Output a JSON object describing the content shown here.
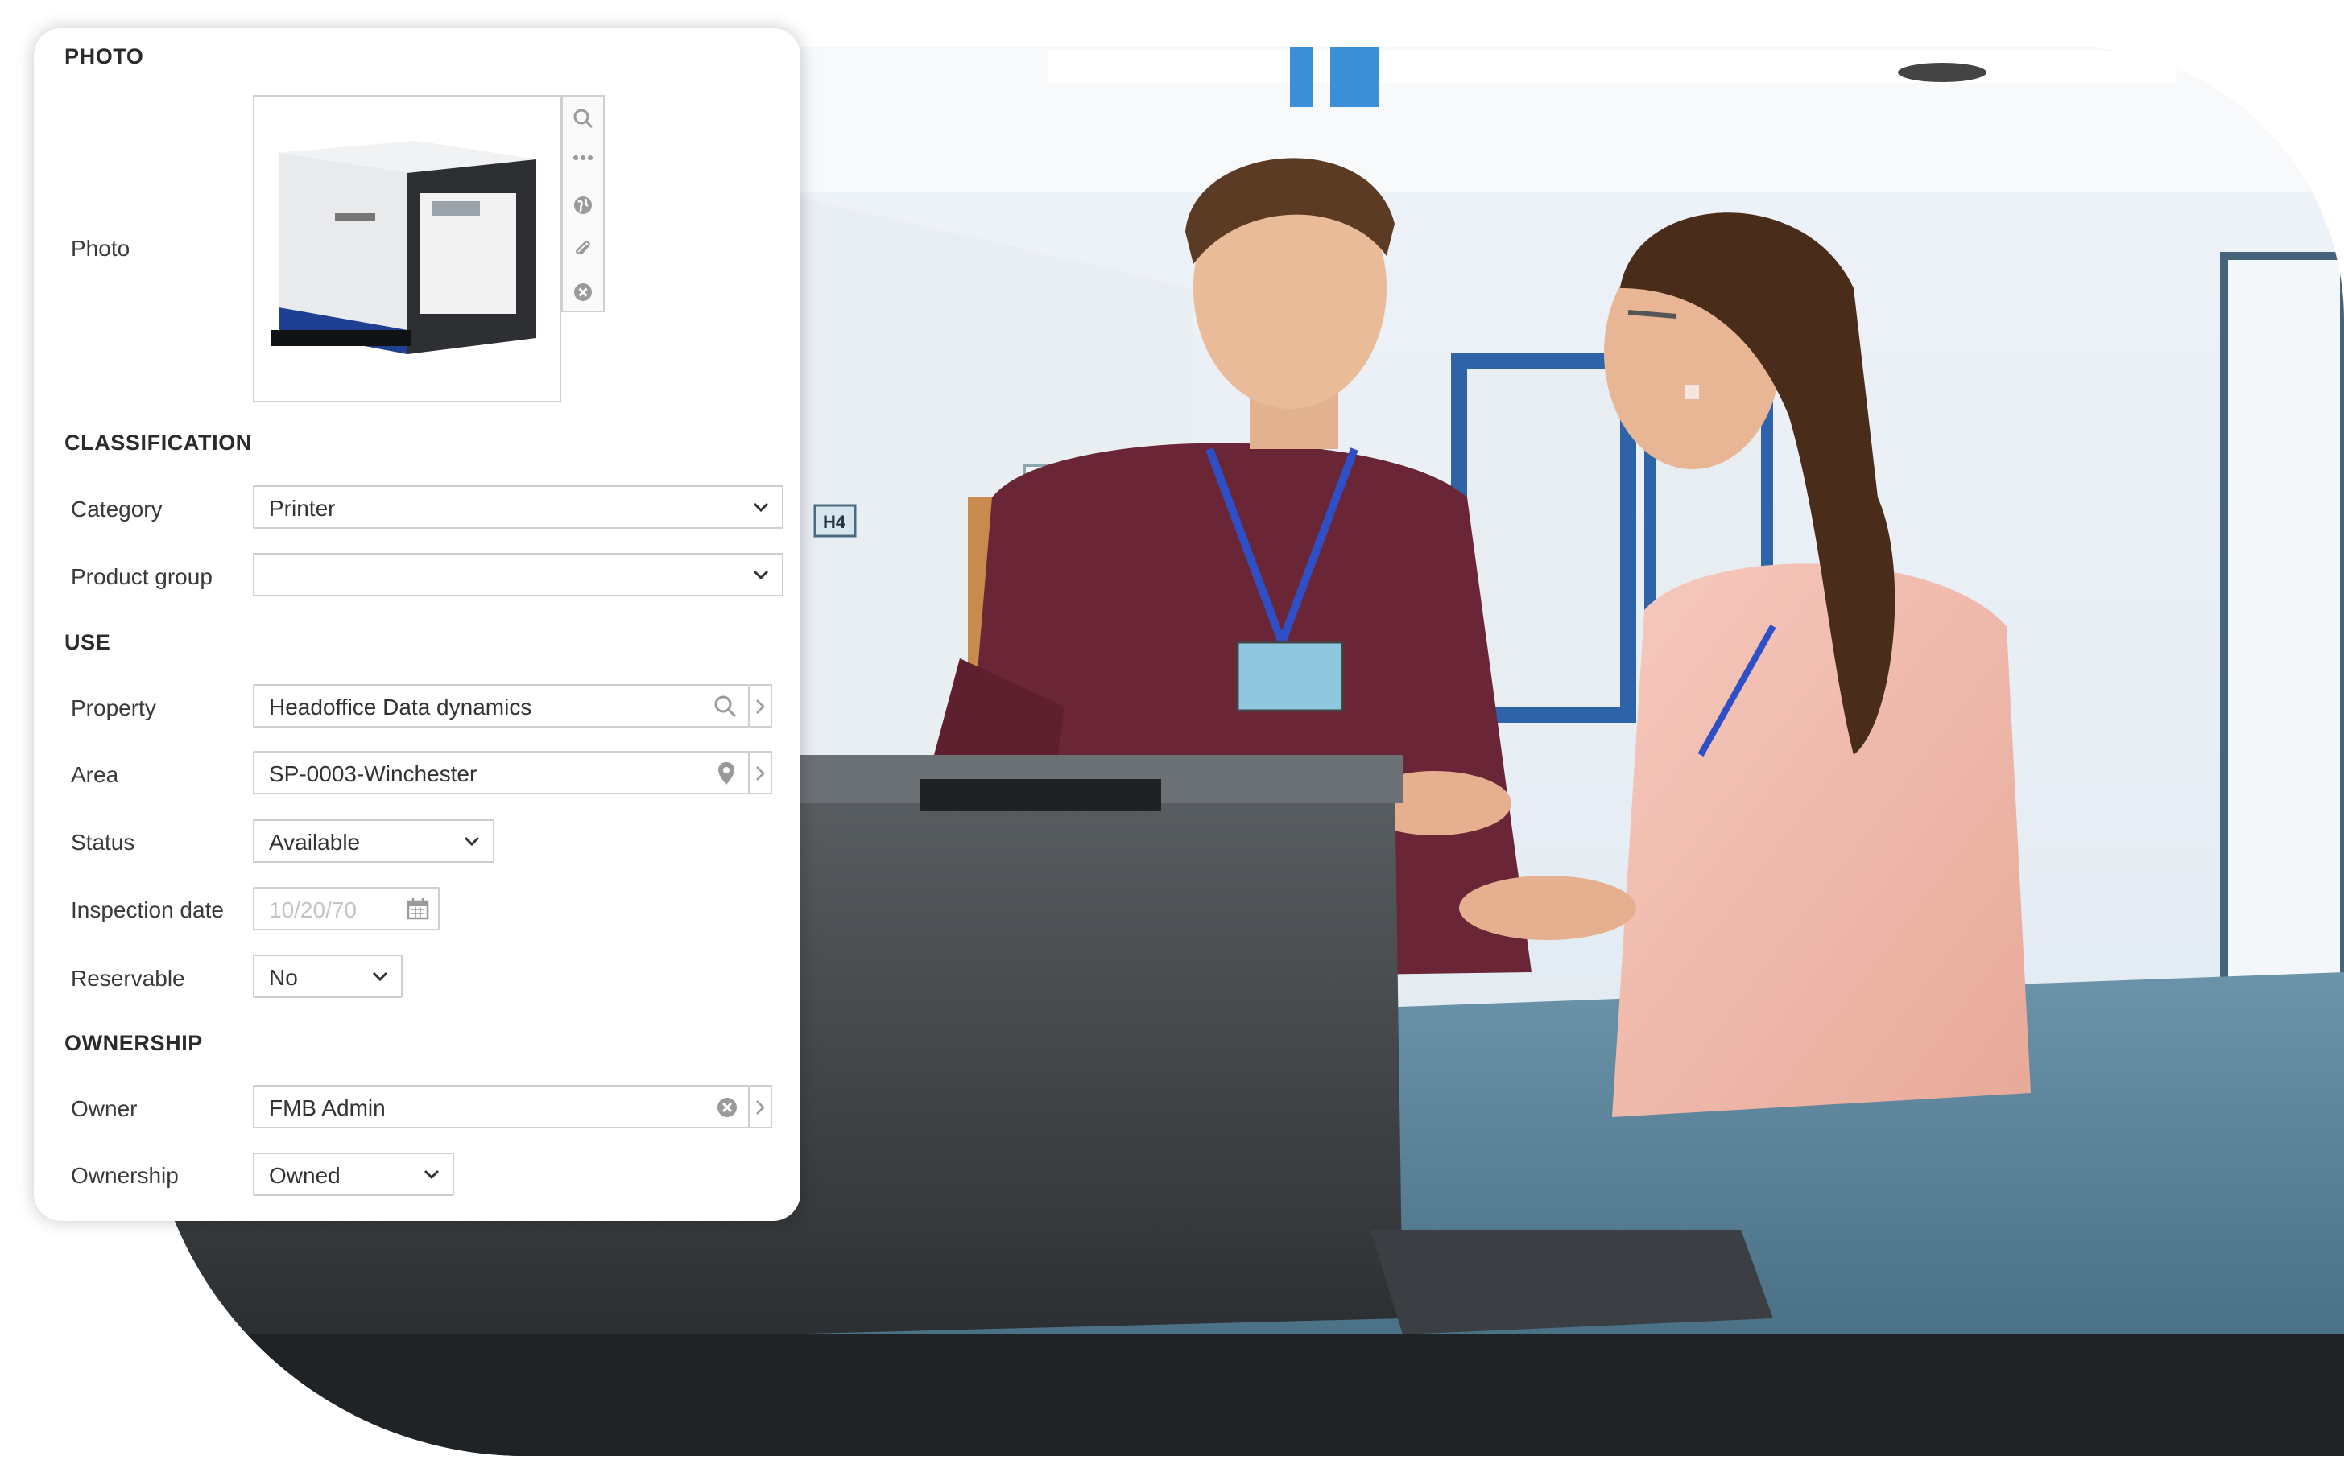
{
  "sections": {
    "photo": "PHOTO",
    "classification": "CLASSIFICATION",
    "use": "USE",
    "ownership": "OWNERSHIP"
  },
  "photo": {
    "label": "Photo",
    "tools": [
      "search-icon",
      "more-icon",
      "globe-icon",
      "paperclip-icon",
      "remove-icon"
    ]
  },
  "classification": {
    "category": {
      "label": "Category",
      "value": "Printer"
    },
    "product_group": {
      "label": "Product group",
      "value": ""
    }
  },
  "use": {
    "property": {
      "label": "Property",
      "value": "Headoffice Data dynamics"
    },
    "area": {
      "label": "Area",
      "value": "SP-0003-Winchester"
    },
    "status": {
      "label": "Status",
      "value": "Available"
    },
    "inspection_date": {
      "label": "Inspection date",
      "placeholder": "10/20/70"
    },
    "reservable": {
      "label": "Reservable",
      "value": "No"
    }
  },
  "ownership": {
    "owner": {
      "label": "Owner",
      "value": "FMB Admin"
    },
    "ownership": {
      "label": "Ownership",
      "value": "Owned"
    }
  },
  "scene": {
    "door_sign": "H4"
  },
  "colors": {
    "section_text": "#2b2b2b",
    "field_border": "#cfcfcf",
    "icon_gray": "#9a9a9a"
  }
}
